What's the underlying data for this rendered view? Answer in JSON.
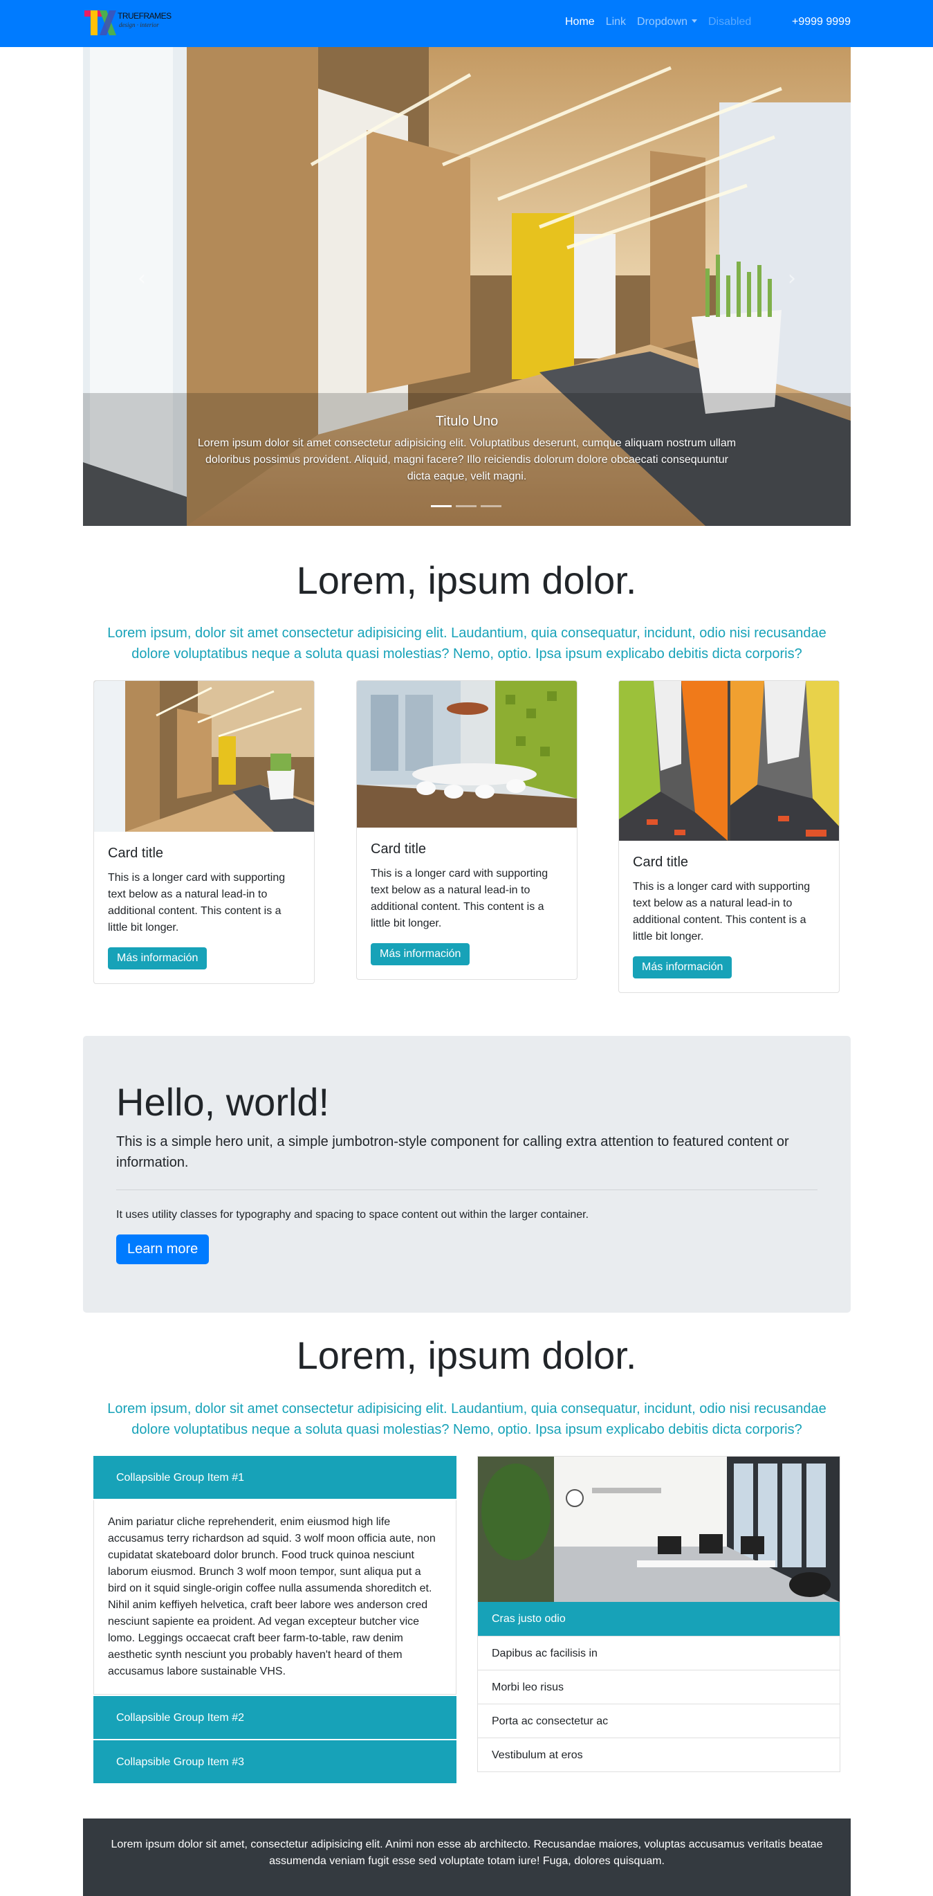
{
  "navbar": {
    "brand_text": "TRUEFRAMES",
    "brand_sub": "design · interior",
    "links": [
      {
        "label": "Home"
      },
      {
        "label": "Link"
      },
      {
        "label": "Dropdown"
      },
      {
        "label": "Disabled"
      }
    ],
    "phone": "+9999 9999"
  },
  "carousel": {
    "caption_title": "Titulo Uno",
    "caption_text": "Lorem ipsum dolor sit amet consectetur adipisicing elit. Voluptatibus deserunt, cumque aliquam nostrum ullam doloribus possimus provident. Aliquid, magni facere? Illo reiciendis dolorum dolore obcaecati consequuntur dicta eaque, velit magni.",
    "prev_icon": "chevron-left-icon",
    "next_icon": "chevron-right-icon",
    "slide_count": 3,
    "active_slide": 1
  },
  "section1": {
    "title": "Lorem, ipsum dolor.",
    "lead": "Lorem ipsum, dolor sit amet consectetur adipisicing elit. Laudantium, quia consequatur, incidunt, odio nisi recusandae dolore voluptatibus neque a soluta quasi molestias? Nemo, optio. Ipsa ipsum explicabo debitis dicta corporis?"
  },
  "cards": [
    {
      "title": "Card title",
      "text": "This is a longer card with supporting text below as a natural lead-in to additional content. This content is a little bit longer.",
      "button": "Más información"
    },
    {
      "title": "Card title",
      "text": "This is a longer card with supporting text below as a natural lead-in to additional content. This content is a little bit longer.",
      "button": "Más información"
    },
    {
      "title": "Card title",
      "text": "This is a longer card with supporting text below as a natural lead-in to additional content. This content is a little bit longer.",
      "button": "Más información"
    }
  ],
  "jumbotron": {
    "title": "Hello, world!",
    "lead": "This is a simple hero unit, a simple jumbotron-style component for calling extra attention to featured content or information.",
    "text": "It uses utility classes for typography and spacing to space content out within the larger container.",
    "button": "Learn more"
  },
  "section2": {
    "title": "Lorem, ipsum dolor.",
    "lead": "Lorem ipsum, dolor sit amet consectetur adipisicing elit. Laudantium, quia consequatur, incidunt, odio nisi recusandae dolore voluptatibus neque a soluta quasi molestias? Nemo, optio. Ipsa ipsum explicabo debitis dicta corporis?"
  },
  "accordion": {
    "items": [
      {
        "label": "Collapsible Group Item #1"
      },
      {
        "label": "Collapsible Group Item #2"
      },
      {
        "label": "Collapsible Group Item #3"
      }
    ],
    "body": "Anim pariatur cliche reprehenderit, enim eiusmod high life accusamus terry richardson ad squid. 3 wolf moon officia aute, non cupidatat skateboard dolor brunch. Food truck quinoa nesciunt laborum eiusmod. Brunch 3 wolf moon tempor, sunt aliqua put a bird on it squid single-origin coffee nulla assumenda shoreditch et. Nihil anim keffiyeh helvetica, craft beer labore wes anderson cred nesciunt sapiente ea proident. Ad vegan excepteur butcher vice lomo. Leggings occaecat craft beer farm-to-table, raw denim aesthetic synth nesciunt you probably haven't heard of them accusamus labore sustainable VHS."
  },
  "list_group": {
    "items": [
      "Cras justo odio",
      "Dapibus ac facilisis in",
      "Morbi leo risus",
      "Porta ac consectetur ac",
      "Vestibulum at eros"
    ]
  },
  "footer": {
    "text": "Lorem ipsum dolor sit amet, consectetur adipisicing elit. Animi non esse ab architecto. Recusandae maiores, voluptas accusamus veritatis beatae assumenda veniam fugit esse sed voluptate totam iure! Fuga, dolores quisquam."
  },
  "colors": {
    "primary": "#007bff",
    "info": "#17a2b8",
    "jumbotron_bg": "#e9ecef",
    "footer_bg": "#343a40"
  }
}
